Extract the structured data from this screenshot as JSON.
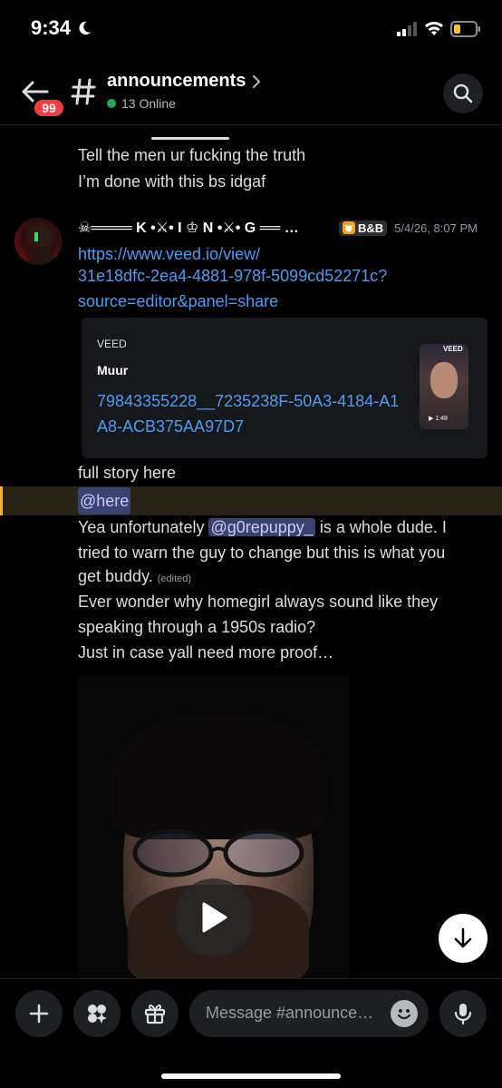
{
  "status_bar": {
    "time": "9:34"
  },
  "header": {
    "unread_count": "99",
    "channel_name": "announcements",
    "online_count": "13 Online"
  },
  "messages": {
    "prev_line_1": "Tell the men ur fucking the truth",
    "prev_line_2": "I’m done with this bs idgaf",
    "author": "☠︎════ K •⚔• I ♔ N •⚔• G ══ …",
    "role_tag": "B&B",
    "timestamp": "5/4/26, 8:07 PM",
    "link_line_1": "https://www.veed.io/view/",
    "link_line_2": "31e18dfc-2ea4-4881-978f-5099cd52271c?",
    "link_line_3": "source=editor&panel=share",
    "embed": {
      "provider": "VEED",
      "title": "Muur",
      "description": "79843355228__7235238F-50A3-4184-A1A8-ACB375AA97D7",
      "thumb_label": "VEED",
      "thumb_duration": "▶ 1:48"
    },
    "full_story": "full story here",
    "here_mention": "@here",
    "line_yea_prefix": "Yea unfortunately ",
    "user_mention": "@g0repuppy_",
    "line_yea_suffix": "  is a whole dude. I",
    "line_tried": "tried to warn the guy to change but this is what you",
    "line_buddy": "get buddy. ",
    "edited": "(edited)",
    "line_wonder_1": "Ever wonder why homegirl always sound like they",
    "line_wonder_2": "speaking through a 1950s radio?",
    "line_proof": "Just in case yall need more proof…"
  },
  "composer": {
    "placeholder": "Message #announce…"
  }
}
